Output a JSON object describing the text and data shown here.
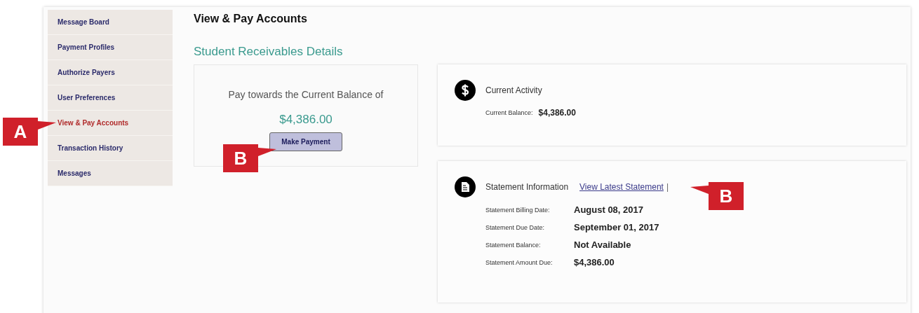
{
  "sidebar": {
    "items": [
      {
        "label": "Message Board",
        "selected": false
      },
      {
        "label": "Payment Profiles",
        "selected": false
      },
      {
        "label": "Authorize Payers",
        "selected": false
      },
      {
        "label": "User Preferences",
        "selected": false
      },
      {
        "label": "View & Pay Accounts",
        "selected": true
      },
      {
        "label": "Transaction History",
        "selected": false
      },
      {
        "label": "Messages",
        "selected": false
      }
    ]
  },
  "page_title": "View & Pay Accounts",
  "section_title": "Student Receivables Details",
  "pay_card": {
    "prompt": "Pay towards the Current Balance of",
    "amount": "$4,386.00",
    "button": "Make Payment"
  },
  "current_activity": {
    "title": "Current Activity",
    "fields": [
      {
        "label": "Current Balance:",
        "value": "$4,386.00"
      }
    ]
  },
  "statement": {
    "title": "Statement Information",
    "link": "View Latest Statement",
    "separator": "|",
    "fields": [
      {
        "label": "Statement Billing Date:",
        "value": "August 08, 2017"
      },
      {
        "label": "Statement Due Date:",
        "value": "September 01, 2017"
      },
      {
        "label": "Statement Balance:",
        "value": "Not Available"
      },
      {
        "label": "Statement Amount Due:",
        "value": "$4,386.00"
      }
    ]
  },
  "callouts": [
    {
      "label": "A"
    },
    {
      "label": "B"
    },
    {
      "label": "B"
    }
  ]
}
